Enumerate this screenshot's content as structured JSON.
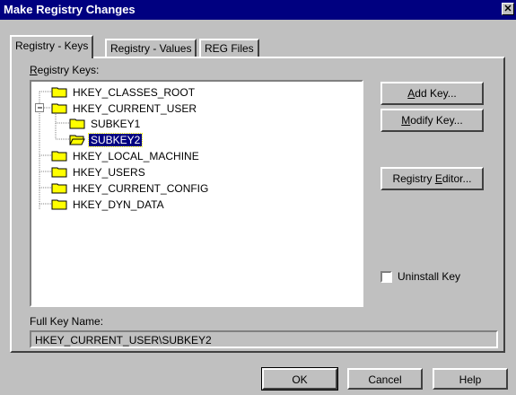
{
  "window": {
    "title": "Make Registry Changes",
    "close_glyph": "✕"
  },
  "tabs": [
    {
      "label": "Registry - Keys"
    },
    {
      "label": "Registry - Values"
    },
    {
      "label": "REG Files"
    }
  ],
  "tree": {
    "label_prefix": "",
    "label_accel": "R",
    "label_rest": "egistry Keys:",
    "nodes": [
      {
        "label": "HKEY_CLASSES_ROOT"
      },
      {
        "label": "HKEY_CURRENT_USER",
        "expanded": true
      },
      {
        "label": "SUBKEY1"
      },
      {
        "label": "SUBKEY2",
        "selected": true
      },
      {
        "label": "HKEY_LOCAL_MACHINE"
      },
      {
        "label": "HKEY_USERS"
      },
      {
        "label": "HKEY_CURRENT_CONFIG"
      },
      {
        "label": "HKEY_DYN_DATA"
      }
    ]
  },
  "buttons": {
    "add_key": {
      "pre": "",
      "accel": "A",
      "post": "dd Key..."
    },
    "modify_key": {
      "pre": "",
      "accel": "M",
      "post": "odify Key..."
    },
    "registry_editor": {
      "pre": "Registry ",
      "accel": "E",
      "post": "ditor..."
    },
    "ok": "OK",
    "cancel": "Cancel",
    "help": "Help"
  },
  "uninstall_key": {
    "label": "Uninstall Key",
    "checked": false
  },
  "full_key": {
    "label": "Full Key Name:",
    "value": "HKEY_CURRENT_USER\\SUBKEY2"
  },
  "colors": {
    "titlebar": "#000080",
    "face": "#c0c0c0",
    "selection": "#000080",
    "folder": "#ffff00"
  }
}
